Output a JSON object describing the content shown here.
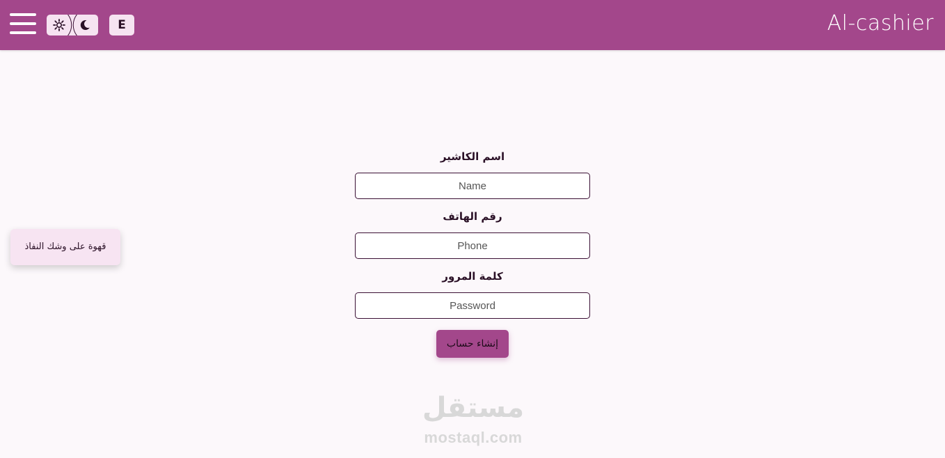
{
  "header": {
    "brand": "Al-cashier",
    "language_button": "E",
    "theme_toggle": {
      "light_icon": "gear-sun-icon",
      "dark_icon": "moon-icon"
    },
    "menu_icon": "hamburger-menu-icon"
  },
  "form": {
    "fields": [
      {
        "label": "اسم الكاشير",
        "placeholder": "Name",
        "value": ""
      },
      {
        "label": "رقم الهاتف",
        "placeholder": "Phone",
        "value": ""
      },
      {
        "label": "كلمة المرور",
        "placeholder": "Password",
        "value": ""
      }
    ],
    "submit_label": "إنشاء حساب"
  },
  "notification": {
    "text": "قهوة على وشك النفاذ"
  },
  "watermark": {
    "arabic": "مستقل",
    "latin": "mostaql.com"
  },
  "colors": {
    "primary": "#a3478b",
    "background": "#fcf8fb",
    "toggle_bg": "#f6e3f1",
    "input_border": "#3a1034"
  }
}
